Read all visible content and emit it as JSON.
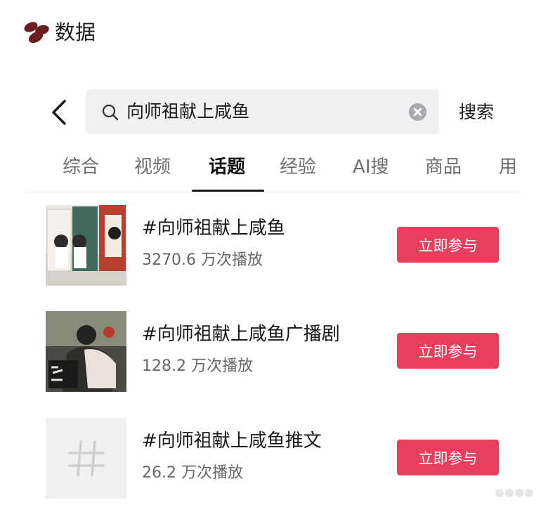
{
  "header": {
    "title": "数据"
  },
  "search": {
    "query": "向师祖献上咸鱼",
    "button_label": "搜索"
  },
  "tabs": [
    {
      "label": "综合"
    },
    {
      "label": "视频"
    },
    {
      "label": "话题"
    },
    {
      "label": "经验"
    },
    {
      "label": "AI搜"
    },
    {
      "label": "商品"
    },
    {
      "label": "用"
    }
  ],
  "active_tab": "话题",
  "results": [
    {
      "title": "#向师祖献上咸鱼",
      "plays": "3270.6 万次播放",
      "button": "立即参与"
    },
    {
      "title": "#向师祖献上咸鱼广播剧",
      "plays": "128.2 万次播放",
      "button": "立即参与"
    },
    {
      "title": "#向师祖献上咸鱼推文",
      "plays": "26.2 万次播放",
      "button": "立即参与"
    }
  ],
  "colors": {
    "accent": "#e8405c",
    "bean": "#6b1e21"
  },
  "icons": {
    "logo": "beans-icon",
    "back": "back-arrow-icon",
    "search": "search-icon",
    "clear": "clear-icon",
    "topic": "hashtag-icon"
  }
}
